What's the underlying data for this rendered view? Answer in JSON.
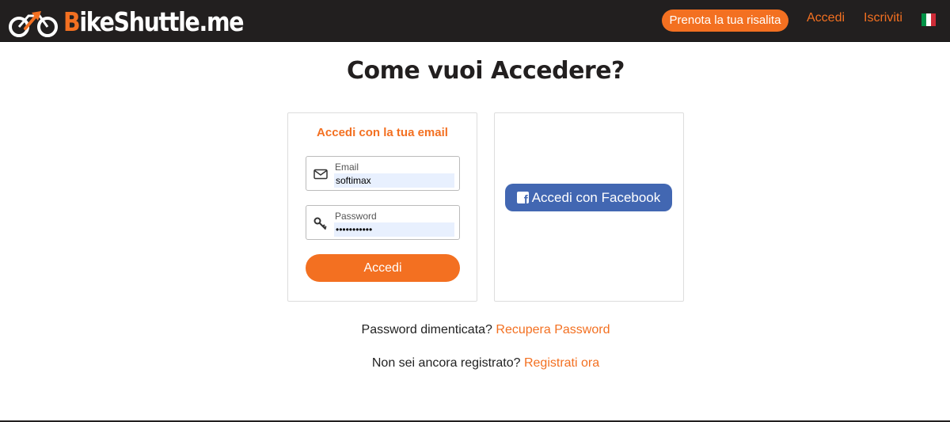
{
  "header": {
    "logo_text_initial": "B",
    "logo_text_rest": "ikeShuttle.me",
    "cta_label": "Prenota la tua risalita",
    "login_link": "Accedi",
    "signup_link": "Iscriviti",
    "language_flag": "italy-flag"
  },
  "page": {
    "title": "Come vuoi Accedere?"
  },
  "email_card": {
    "heading": "Accedi con la tua email",
    "email_label": "Email",
    "email_value": "softimax",
    "password_label": "Password",
    "password_value": "•••••••••••",
    "submit_label": "Accedi",
    "email_icon": "envelope-icon",
    "password_icon": "key-icon"
  },
  "facebook_card": {
    "button_label": "Accedi con Facebook",
    "icon": "facebook-icon"
  },
  "footer_links": {
    "forgot_text": "Password dimenticata?",
    "forgot_link": "Recupera Password",
    "register_text": "Non sei ancora registrato?",
    "register_link": "Registrati ora"
  },
  "colors": {
    "brand": "#f37021",
    "header_bg": "#221f1f",
    "facebook": "#4267b2"
  }
}
